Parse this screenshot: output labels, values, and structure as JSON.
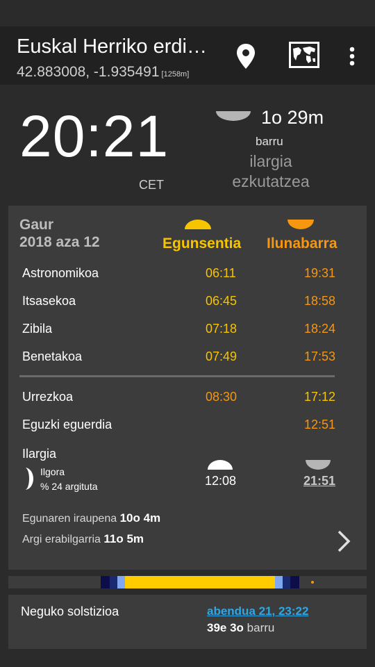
{
  "header": {
    "title": "Euskal Herriko erdi…",
    "coords": "42.883008, -1.935491",
    "altitude": "[1258m]"
  },
  "clock": {
    "time": "20:21",
    "timezone": "CET"
  },
  "next_event": {
    "duration": "1o 29m",
    "in_word": "barru",
    "label_line1": "ilargia",
    "label_line2": "ezkutatzea"
  },
  "today": {
    "label": "Gaur",
    "date": "2018 aza 12",
    "header_rise": "Egunsentia",
    "header_set": "Ilunabarra",
    "rows": [
      {
        "label": "Astronomikoa",
        "rise": "06:11",
        "set": "19:31"
      },
      {
        "label": "Itsasekoa",
        "rise": "06:45",
        "set": "18:58"
      },
      {
        "label": "Zibila",
        "rise": "07:18",
        "set": "18:24"
      },
      {
        "label": "Benetakoa",
        "rise": "07:49",
        "set": "17:53"
      }
    ],
    "golden": {
      "label": "Urrezkoa",
      "rise": "08:30",
      "set": "17:12"
    },
    "noon": {
      "label": "Eguzki eguerdia",
      "time": "12:51"
    },
    "moon": {
      "label": "Ilargia",
      "phase": "Ilgora",
      "illumination": "% 24 argituta",
      "rise": "12:08",
      "set": "21:51"
    },
    "day_length_label": "Egunaren iraupena",
    "day_length": "10o 4m",
    "usable_light_label": "Argi erabilgarria",
    "usable_light": "11o 5m"
  },
  "event": {
    "name": "Neguko solstizioa",
    "date": "abendua 21, 23:22",
    "in_value": "39e 3o",
    "in_word": "barru"
  },
  "colors": {
    "sunrise": "#f7c500",
    "sunset": "#f7960f",
    "link": "#2fa7e6"
  },
  "timeline": {
    "night_color": "#0d0d4a",
    "astronomical_color": "#1a2a70",
    "civil_color": "#7fa8f0",
    "day_color": "#ffcc00",
    "now_dot_color": "#f7960f"
  }
}
